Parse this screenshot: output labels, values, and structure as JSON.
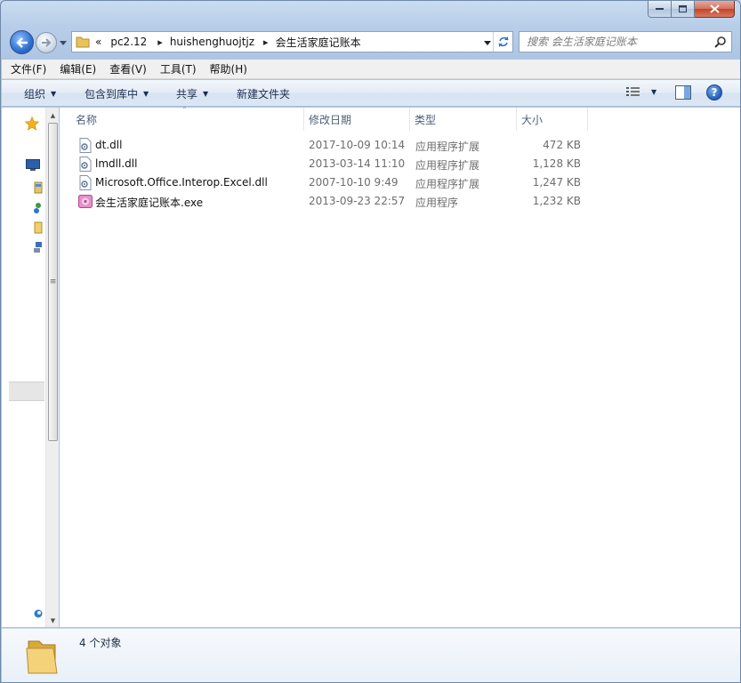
{
  "window": {
    "caption": {
      "minimize_icon": "minimize-icon",
      "maximize_icon": "maximize-icon",
      "close_icon": "close-icon"
    }
  },
  "address_bar": {
    "overflow": "«",
    "breadcrumbs": [
      "pc2.12",
      "huishenghuojtjz",
      "会生活家庭记账本"
    ]
  },
  "search": {
    "placeholder": "搜索 会生活家庭记账本"
  },
  "menu": [
    "文件(F)",
    "编辑(E)",
    "查看(V)",
    "工具(T)",
    "帮助(H)"
  ],
  "commands": {
    "organize": "组织",
    "include_in_library": "包含到库中",
    "share": "共享",
    "new_folder": "新建文件夹"
  },
  "columns": {
    "name": "名称",
    "modified": "修改日期",
    "type": "类型",
    "size": "大小"
  },
  "files": [
    {
      "name": "dt.dll",
      "modified": "2017-10-09 10:14",
      "type": "应用程序扩展",
      "size": "472 KB",
      "icon": "dll-file-icon"
    },
    {
      "name": "lmdll.dll",
      "modified": "2013-03-14 11:10",
      "type": "应用程序扩展",
      "size": "1,128 KB",
      "icon": "dll-file-icon"
    },
    {
      "name": "Microsoft.Office.Interop.Excel.dll",
      "modified": "2007-10-10 9:49",
      "type": "应用程序扩展",
      "size": "1,247 KB",
      "icon": "dll-file-icon"
    },
    {
      "name": "会生活家庭记账本.exe",
      "modified": "2013-09-23 22:57",
      "type": "应用程序",
      "size": "1,232 KB",
      "icon": "exe-app-icon"
    }
  ],
  "details": {
    "item_count": "4 个对象"
  },
  "colors": {
    "accent": "#2f6fd0",
    "selection": "#cce8ff",
    "close": "#c1442a"
  }
}
